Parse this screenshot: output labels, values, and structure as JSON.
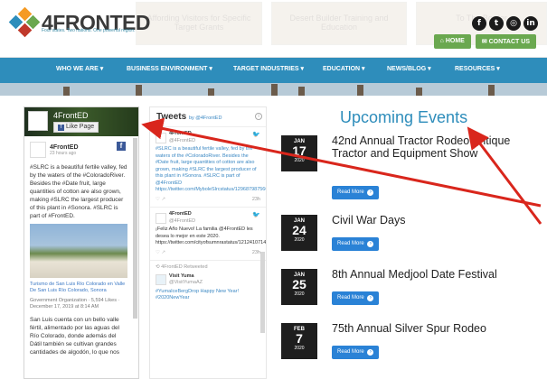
{
  "header": {
    "logo_prefix": "4",
    "logo_text": "FRONTED",
    "tagline": "Four states. Two nations. One powerful region.",
    "bg_tiles": [
      "Affording Visitors for Specific Target Grants",
      "Desert Builder Training and Education",
      "To The Border"
    ],
    "social_icons": [
      "facebook-icon",
      "twitter-icon",
      "instagram-icon",
      "linkedin-icon"
    ],
    "home_label": "HOME",
    "contact_label": "CONTACT US"
  },
  "nav": {
    "items": [
      "WHO WE ARE",
      "BUSINESS ENVIRONMENT",
      "TARGET INDUSTRIES",
      "EDUCATION",
      "NEWS/BLOG",
      "RESOURCES"
    ]
  },
  "facebook": {
    "page_name": "4FrontED",
    "like_label": "Like Page",
    "post": {
      "author": "4FrontED",
      "time": "23 hours ago",
      "text": "#SLRC is a beautiful fertile valley, fed by the waters of the #ColoradoRiver. Besides the #Date fruit, large quantities of cotton are also grown, making #SLRC the largest producer of this plant in #Sonora. #SLRC is part of #FrontED.",
      "link_title": "Turismo de San Luis Río Colorado en Valle De San Luis Río Colorado, Sonora",
      "org_line": "Government Organization · 5,594 Likes · December 17, 2019 at 8:14 AM",
      "text_es": "San Luis cuenta con un bello valle fértil, alimentado por las aguas del Río Colorado, donde además del Dátil también se cultivan grandes cantidades de algodón, lo que nos"
    }
  },
  "tweets": {
    "title": "Tweets",
    "by": "by @4FrontED",
    "items": [
      {
        "author": "4FrontED",
        "handle": "@4FrontED",
        "text": "#SLRC is a beautiful fertile valley, fed by the waters of the #ColoradoRiver. Besides the #Date fruit, large quantities of cotton are also grown, making #SLRC the largest producer of this plant in #Sonora. #SLRC is part of @4FrontED https://twitter.com/MyboleSlrcstatus/129687987560976746",
        "ago": "23h"
      },
      {
        "author": "4FrontED",
        "handle": "@4FrontED",
        "text": "¡Feliz Año Nuevo! La familia @4FrontED les desea lo mejor en este 2020. https://twitter.com/cityofsumnrastatus/121241071485839746",
        "ago": "23h"
      },
      {
        "retweet": "4FrontED Retweeted",
        "author": "Visit Yuma",
        "handle": "@VisitYumaAZ",
        "text": "#YumaIceBergDrop Happy New Year! #2020NewYear",
        "ago": ""
      }
    ]
  },
  "events": {
    "title": "Upcoming Events",
    "read_more": "Read More",
    "items": [
      {
        "month": "JAN",
        "day": "17",
        "year": "2020",
        "name": "42nd Annual Tractor Rodeo Antique Tractor and Equipment Show"
      },
      {
        "month": "JAN",
        "day": "24",
        "year": "2020",
        "name": "Civil War Days"
      },
      {
        "month": "JAN",
        "day": "25",
        "year": "2020",
        "name": "8th Annual Medjool Date Festival"
      },
      {
        "month": "FEB",
        "day": "7",
        "year": "2020",
        "name": "75th Annual Silver Spur Rodeo"
      }
    ]
  },
  "colors": {
    "nav": "#2e8dbb",
    "accent_orange": "#f26a2e",
    "button_green": "#6aa84f",
    "read_more_blue": "#2a82d6",
    "annotation_red": "#d9261c"
  }
}
